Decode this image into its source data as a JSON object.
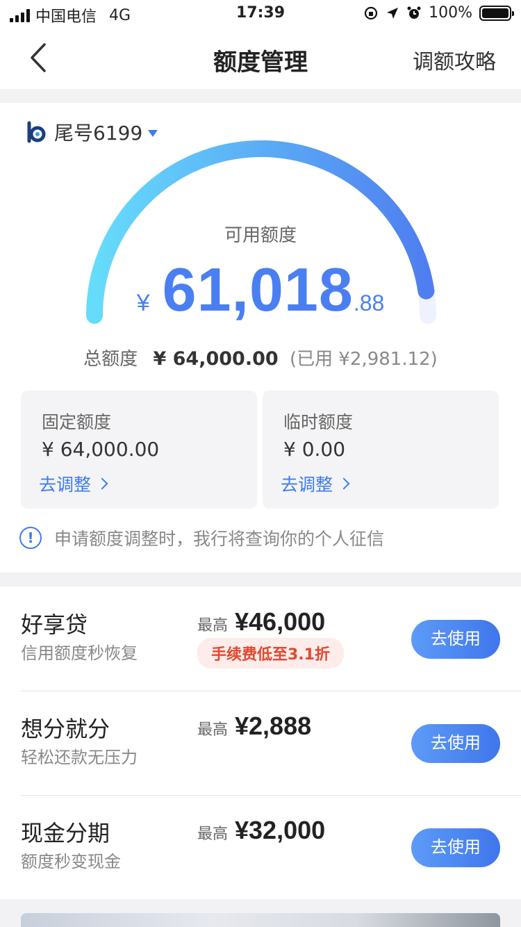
{
  "status": {
    "carrier": "中国电信",
    "network": "4G",
    "time": "17:39",
    "battery": "100%"
  },
  "nav": {
    "title": "额度管理",
    "right_link": "调额攻略"
  },
  "card": {
    "label": "尾号6199"
  },
  "available": {
    "label": "可用额度",
    "currency": "¥",
    "integer": "61,018",
    "decimal": ".88",
    "fraction_of_total": 0.953
  },
  "total": {
    "label": "总额度",
    "value": "¥ 64,000.00",
    "used": "(已用 ¥2,981.12)"
  },
  "quotas": [
    {
      "title": "固定额度",
      "value": "¥ 64,000.00",
      "link": "去调整"
    },
    {
      "title": "临时额度",
      "value": "¥ 0.00",
      "link": "去调整"
    }
  ],
  "notice": {
    "text": "申请额度调整时，我行将查询你的个人征信"
  },
  "products": [
    {
      "name": "好享贷",
      "desc": "信用额度秒恢复",
      "max_label": "最高",
      "max_value": "¥46,000",
      "tag": "手续费低至3.1折",
      "button": "去使用"
    },
    {
      "name": "想分就分",
      "desc": "轻松还款无压力",
      "max_label": "最高",
      "max_value": "¥2,888",
      "button": "去使用"
    },
    {
      "name": "现金分期",
      "desc": "额度秒变现金",
      "max_label": "最高",
      "max_value": "¥32,000",
      "button": "去使用"
    }
  ],
  "colors": {
    "accent": "#3d7bf0",
    "gauge_start": "#66dcfb",
    "gauge_end": "#4f7ef0",
    "gauge_track": "#eef2fd",
    "tag_text": "#e5462e"
  }
}
